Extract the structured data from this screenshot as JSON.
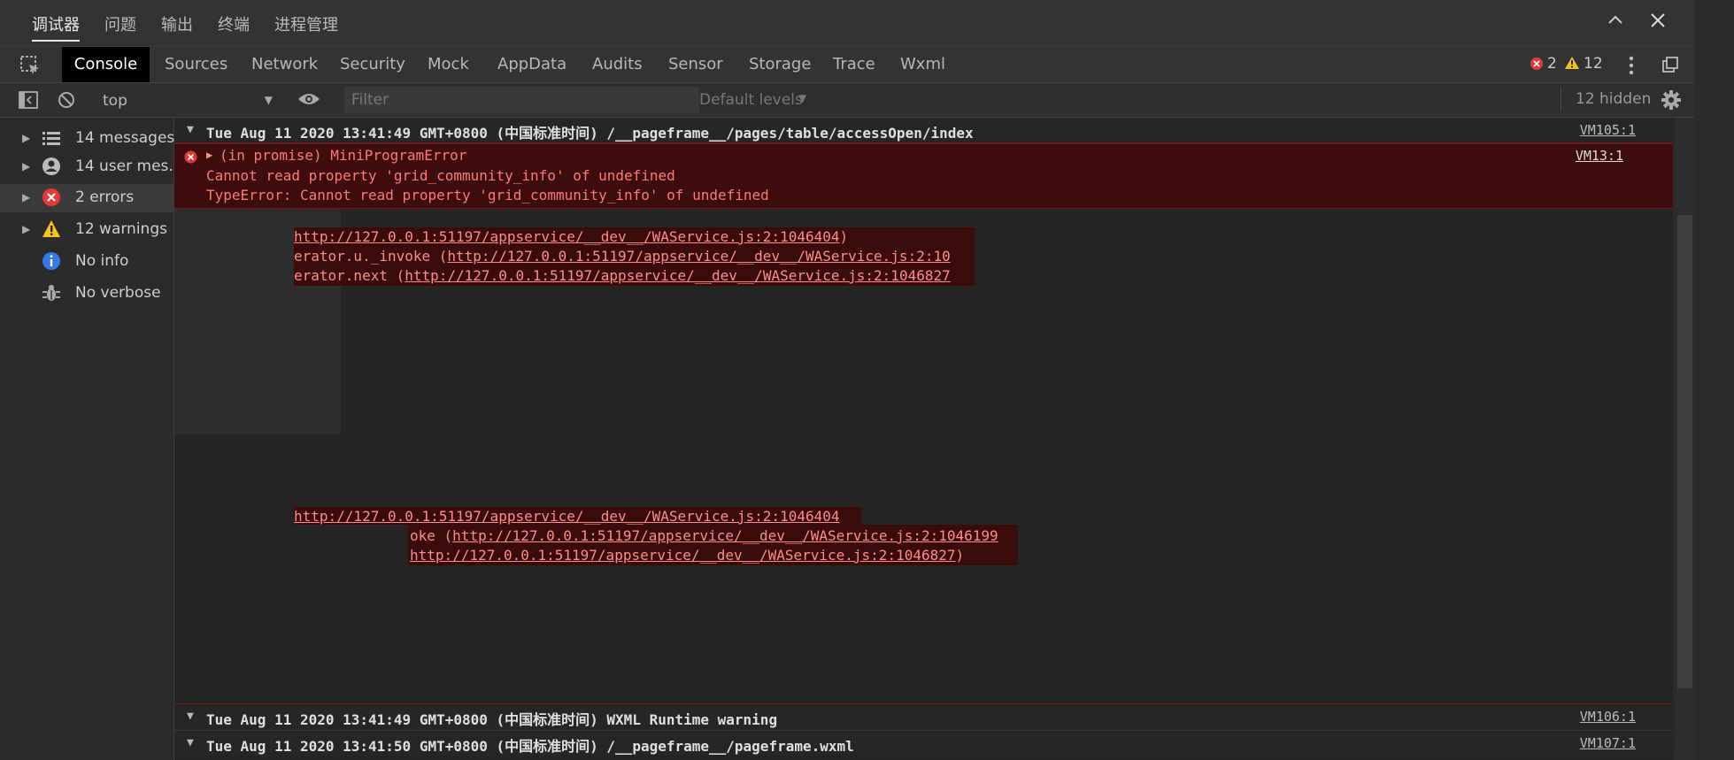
{
  "panel_tabs": [
    "调试器",
    "问题",
    "输出",
    "终端",
    "进程管理"
  ],
  "devtools_tabs": [
    "Console",
    "Sources",
    "Network",
    "Security",
    "Mock",
    "AppData",
    "Audits",
    "Sensor",
    "Storage",
    "Trace",
    "Wxml"
  ],
  "badges": {
    "errors": "2",
    "warnings": "12"
  },
  "filterbar": {
    "context": "top",
    "filter_placeholder": "Filter",
    "levels": "Default levels",
    "hidden": "12 hidden"
  },
  "sidebar": [
    {
      "label": "14 messages",
      "icon": "list-icon"
    },
    {
      "label": "14 user mes...",
      "icon": "user-icon"
    },
    {
      "label": "2 errors",
      "icon": "error-icon"
    },
    {
      "label": "12 warnings",
      "icon": "warning-icon"
    },
    {
      "label": "No info",
      "icon": "info-icon"
    },
    {
      "label": "No verbose",
      "icon": "bug-icon"
    }
  ],
  "console": {
    "group1": {
      "title": "Tue Aug 11 2020 13:41:49 GMT+0800 (中国标准时间) /__pageframe__/pages/table/accessOpen/index",
      "source": "VM105:1"
    },
    "error": {
      "head": "(in promise) MiniProgramError",
      "line2": "Cannot read property 'grid_community_info' of undefined",
      "line3": "TypeError: Cannot read property 'grid_community_info' of undefined",
      "source": "VM13:1"
    },
    "stack1": [
      {
        "prefix": "",
        "link": "http://127.0.0.1:51197/appservice/__dev__/WAService.js:2:1046404",
        "suffix": ")"
      },
      {
        "prefix": "erator.u._invoke (",
        "link": "http://127.0.0.1:51197/appservice/__dev__/WAService.js:2:10",
        "suffix": ""
      },
      {
        "prefix": "erator.next (",
        "link": "http://127.0.0.1:51197/appservice/__dev__/WAService.js:2:1046827",
        "suffix": ""
      }
    ],
    "stack2": [
      {
        "prefix": "",
        "link": "http://127.0.0.1:51197/appservice/__dev__/WAService.js:2:1046404",
        "suffix": ""
      },
      {
        "prefix": "oke (",
        "link": "http://127.0.0.1:51197/appservice/__dev__/WAService.js:2:1046199",
        "suffix": ""
      },
      {
        "prefix": "",
        "link": "http://127.0.0.1:51197/appservice/__dev__/WAService.js:2:1046827",
        "suffix": ")"
      }
    ],
    "group2": {
      "title": "Tue Aug 11 2020 13:41:49 GMT+0800 (中国标准时间) WXML Runtime warning",
      "source": "VM106:1"
    },
    "group3": {
      "title": "Tue Aug 11 2020 13:41:50 GMT+0800 (中国标准时间) /__pageframe__/pageframe.wxml",
      "source": "VM107:1"
    }
  },
  "colors": {
    "error_bg": "#3d0c0c",
    "error_text": "#ff7878",
    "accent": "#000000"
  }
}
